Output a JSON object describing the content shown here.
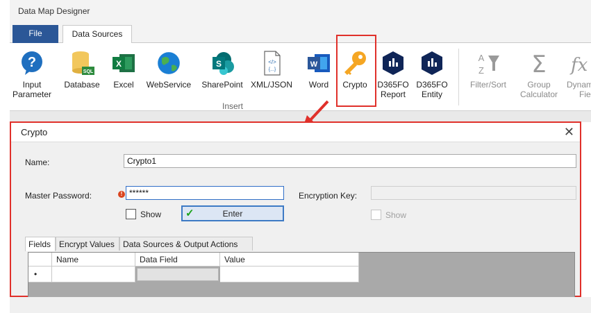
{
  "app": {
    "title": "Data Map Designer"
  },
  "ribbon_tabs": [
    {
      "label": "File"
    },
    {
      "label": "Data Sources"
    }
  ],
  "ribbon": {
    "buttons": [
      {
        "label_line1": "Input",
        "label_line2": "Parameter",
        "icon": "question-icon"
      },
      {
        "label_line1": "Database",
        "label_line2": "",
        "icon": "database-sql-icon"
      },
      {
        "label_line1": "Excel",
        "label_line2": "",
        "icon": "excel-icon"
      },
      {
        "label_line1": "WebService",
        "label_line2": "",
        "icon": "globe-icon"
      },
      {
        "label_line1": "SharePoint",
        "label_line2": "",
        "icon": "sharepoint-icon"
      },
      {
        "label_line1": "XML/JSON",
        "label_line2": "",
        "icon": "code-file-icon"
      },
      {
        "label_line1": "Word",
        "label_line2": "",
        "icon": "word-icon"
      },
      {
        "label_line1": "Crypto",
        "label_line2": "",
        "icon": "key-icon"
      },
      {
        "label_line1": "D365FO",
        "label_line2": "Report",
        "icon": "d365fo-icon"
      },
      {
        "label_line1": "D365FO",
        "label_line2": "Entity",
        "icon": "d365fo-icon"
      },
      {
        "label_line1": "Filter/Sort",
        "label_line2": "",
        "icon": "filter-sort-icon"
      },
      {
        "label_line1": "Group",
        "label_line2": "Calculator",
        "icon": "sigma-icon"
      },
      {
        "label_line1": "Dynam",
        "label_line2": "Field",
        "icon": "function-icon"
      }
    ],
    "group_label": "Insert",
    "colors": {
      "highlight": "#e0302a",
      "file_tab": "#2b5797"
    }
  },
  "dialog": {
    "title": "Crypto",
    "close_glyph": "✕",
    "name_label": "Name:",
    "name_value": "Crypto1",
    "master_password_label": "Master Password:",
    "master_password_value": "******",
    "show_label": "Show",
    "enter_label": "Enter",
    "encryption_key_label": "Encryption Key:",
    "encryption_key_value": "",
    "show_label_2": "Show",
    "tabs": [
      {
        "label": "Fields"
      },
      {
        "label": "Encrypt Values"
      },
      {
        "label": "Data Sources & Output Actions"
      }
    ],
    "grid": {
      "columns": [
        "Name",
        "Data Field",
        "Value"
      ],
      "new_row_marker": "•"
    }
  }
}
